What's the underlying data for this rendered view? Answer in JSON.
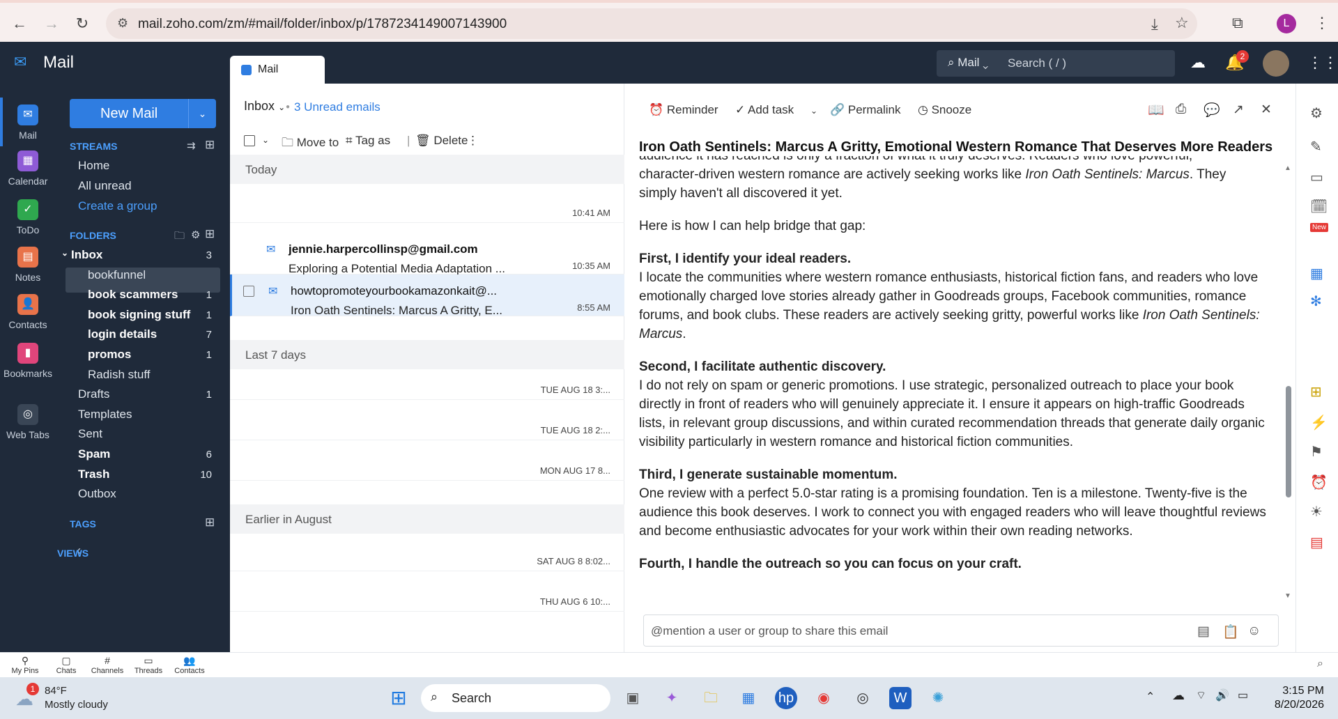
{
  "browser": {
    "url": "mail.zoho.com/zm/#mail/folder/inbox/p/1787234149007143900",
    "profile_initial": "L"
  },
  "app": {
    "title": "Mail",
    "tab_label": "Mail",
    "search_scope": "Mail",
    "search_placeholder": "Search ( / )",
    "notification_count": "2"
  },
  "rail": {
    "items": [
      {
        "label": "Mail",
        "color": "#2f7de1"
      },
      {
        "label": "Calendar",
        "color": "#8e5bd6"
      },
      {
        "label": "ToDo",
        "color": "#2fa84f"
      },
      {
        "label": "Notes",
        "color": "#e8734a"
      },
      {
        "label": "Contacts",
        "color": "#e8734a"
      },
      {
        "label": "Bookmarks",
        "color": "#e0457b"
      },
      {
        "label": "Web Tabs",
        "color": "#3a4656"
      }
    ]
  },
  "folders": {
    "new_mail": "New Mail",
    "streams_heading": "STREAMS",
    "home": "Home",
    "all_unread": "All unread",
    "create_group": "Create a group",
    "folders_heading": "FOLDERS",
    "items": [
      {
        "label": "Inbox",
        "count": "3",
        "bold": true
      },
      {
        "label": "bookfunnel",
        "count": "",
        "bold": false
      },
      {
        "label": "book scammers",
        "count": "1",
        "bold": true
      },
      {
        "label": "book signing stuff",
        "count": "1",
        "bold": true
      },
      {
        "label": "login details",
        "count": "7",
        "bold": true
      },
      {
        "label": "promos",
        "count": "1",
        "bold": true
      },
      {
        "label": "Radish stuff",
        "count": "",
        "bold": false
      },
      {
        "label": "Drafts",
        "count": "1",
        "bold": false
      },
      {
        "label": "Templates",
        "count": "",
        "bold": false
      },
      {
        "label": "Sent",
        "count": "",
        "bold": false
      },
      {
        "label": "Spam",
        "count": "6",
        "bold": true
      },
      {
        "label": "Trash",
        "count": "10",
        "bold": true
      },
      {
        "label": "Outbox",
        "count": "",
        "bold": false
      }
    ],
    "tags_heading": "TAGS",
    "views_heading": "VIEWS"
  },
  "list": {
    "folder": "Inbox",
    "unread": "3 Unread emails",
    "move_to": "Move to",
    "tag_as": "Tag as",
    "delete": "Delete",
    "groups": {
      "today": "Today",
      "last7": "Last 7 days",
      "earlier": "Earlier in August"
    },
    "rows": [
      {
        "from": "",
        "subject": "",
        "time": "10:41 AM"
      },
      {
        "from": "jennie.harpercollinsp@gmail.com",
        "subject": "Exploring a Potential Media Adaptation ...",
        "time": "10:35 AM"
      },
      {
        "from": "howtopromoteyourbookamazonkait@...",
        "subject": "Iron Oath Sentinels: Marcus A Gritty, E...",
        "time": "8:55 AM"
      },
      {
        "from": "",
        "subject": "",
        "time": "TUE AUG 18 3:..."
      },
      {
        "from": "",
        "subject": "",
        "time": "TUE AUG 18 2:..."
      },
      {
        "from": "",
        "subject": "",
        "time": "MON AUG 17 8..."
      },
      {
        "from": "",
        "subject": "",
        "time": "SAT AUG 8 8:02..."
      },
      {
        "from": "",
        "subject": "",
        "time": "THU AUG 6 10:..."
      }
    ]
  },
  "reader": {
    "reminder": "Reminder",
    "add_task": "Add task",
    "permalink": "Permalink",
    "snooze": "Snooze",
    "title": "Iron Oath Sentinels: Marcus A Gritty, Emotional Western Romance That Deserves More Readers",
    "p0_cut": "audience it has reached is only a fraction of what it truly deserves. Readers who love powerful,",
    "p0a": "character-driven western romance are actively seeking works like ",
    "p0_em": "Iron Oath Sentinels: Marcus",
    "p0b": ". They simply haven't all discovered it yet.",
    "p1": "Here is how I can help bridge that gap:",
    "h2": "First, I identify your ideal readers.",
    "p2a": "I locate the communities where western romance enthusiasts, historical fiction fans, and readers who love emotionally charged love stories already gather in Goodreads groups, Facebook communities, romance forums, and book clubs. These readers are actively seeking gritty, powerful works like ",
    "p2_em": "Iron Oath Sentinels: Marcus",
    "p2b": ".",
    "h3": "Second, I facilitate authentic discovery.",
    "p3": "I do not rely on spam or generic promotions. I use strategic, personalized outreach to place your book directly in front of readers who will genuinely appreciate it. I ensure it appears on high-traffic Goodreads lists, in relevant group discussions, and within curated recommendation threads that generate daily organic visibility particularly in western romance and historical fiction communities.",
    "h4": "Third, I generate sustainable momentum.",
    "p4": "One review with a perfect 5.0-star rating is a promising foundation. Ten is a milestone. Twenty-five is the audience this book deserves. I work to connect you with engaged readers who will leave thoughtful reviews and become enthusiastic advocates for your work within their own reading networks.",
    "h5": "Fourth, I handle the outreach so you can focus on your craft.",
    "share_placeholder": "@mention a user or group to share this email"
  },
  "pins": [
    "My Pins",
    "Chats",
    "Channels",
    "Threads",
    "Contacts"
  ],
  "taskbar": {
    "weather_badge": "1",
    "temp": "84°F",
    "condition": "Mostly cloudy",
    "search": "Search",
    "time": "3:15 PM",
    "date": "8/20/2026"
  }
}
